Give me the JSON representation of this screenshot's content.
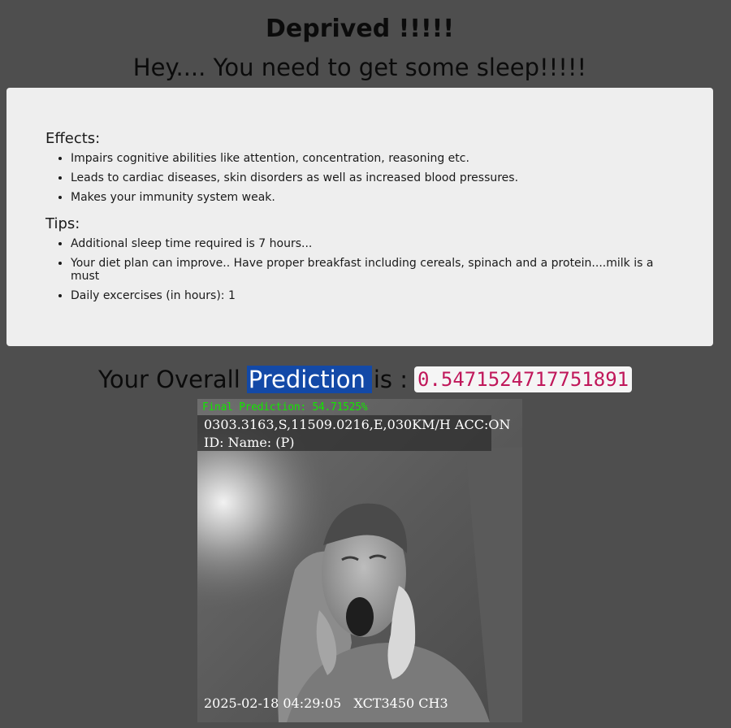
{
  "header": {
    "status": "Deprived !!!!!",
    "message": "Hey.... You need to get some sleep!!!!!"
  },
  "card": {
    "effects_heading": "Effects:",
    "effects": [
      "Impairs cognitive abilities like attention, concentration, reasoning etc.",
      "Leads to cardiac diseases, skin disorders as well as increased blood pressures.",
      "Makes your immunity system weak."
    ],
    "tips_heading": "Tips:",
    "tips": [
      "Additional sleep time required is 7 hours...",
      "Your diet plan can improve.. Have proper breakfast including cereals, spinach and a protein....milk is a must",
      "Daily excercises (in hours): 1"
    ]
  },
  "prediction": {
    "prefix": "Your Overall",
    "highlighted": "Prediction",
    "suffix": "is :",
    "value": "0.5471524717751891"
  },
  "camera": {
    "final_prediction": "Final Prediction: 54.71525%",
    "gps": "0303.3163,S,11509.0216,E,030KM/H ACC:ON",
    "id_line": "ID: Name: (P)",
    "timestamp": "2025-02-18 04:29:05   XCT3450 CH3",
    "accent_color": "#13e600"
  }
}
